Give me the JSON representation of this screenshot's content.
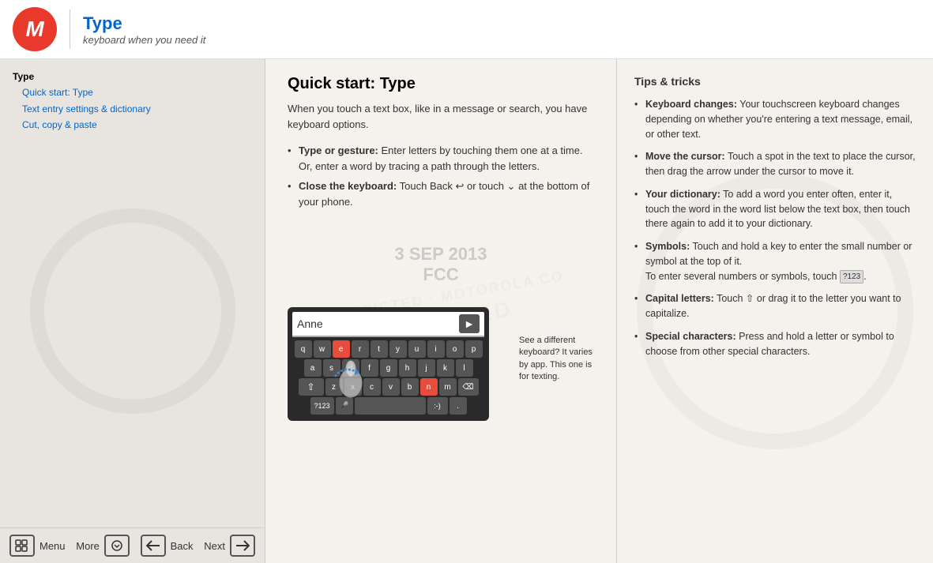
{
  "header": {
    "title": "Type",
    "subtitle": "keyboard when you need it",
    "logo_letter": "M"
  },
  "sidebar": {
    "nav_items": [
      {
        "label": "Type",
        "active": true,
        "indented": false
      },
      {
        "label": "Quick start: Type",
        "active": false,
        "indented": true
      },
      {
        "label": "Text entry settings & dictionary",
        "active": false,
        "indented": true
      },
      {
        "label": "Cut, copy & paste",
        "active": false,
        "indented": true
      }
    ],
    "menu_label": "Menu",
    "more_label": "More",
    "back_label": "Back",
    "next_label": "Next"
  },
  "center": {
    "section_title": "Quick start: Type",
    "intro": "When you touch a text box, like in a message or search, you have keyboard options.",
    "bullets": [
      {
        "bold": "Type or gesture:",
        "text": " Enter letters by touching them one at a time. Or, enter a word by tracing a path through the letters."
      },
      {
        "bold": "Close the keyboard:",
        "text": " Touch Back ↩ or touch ⌄ at the bottom of your phone."
      }
    ],
    "date_stamp": "3 SEP 2013",
    "fcc_text": "FCC",
    "keyboard": {
      "input_text": "Anne",
      "rows": [
        [
          "q",
          "w",
          "e",
          "r",
          "t",
          "y",
          "u",
          "i",
          "o",
          "p"
        ],
        [
          "a",
          "s",
          "d",
          "f",
          "g",
          "h",
          "j",
          "k",
          "l"
        ],
        [
          "⇧",
          "z",
          "x",
          "c",
          "v",
          "b",
          "n",
          "m",
          "⌫"
        ],
        [
          "?123",
          "🎤",
          "",
          "",
          "",
          "",
          "",
          "",
          ":-)",
          "."
        ]
      ]
    },
    "tooltip": "See a different keyboard? It varies by app. This one is for texting."
  },
  "tips": {
    "title": "Tips & tricks",
    "items": [
      {
        "bold": "Keyboard changes:",
        "text": " Your touchscreen keyboard changes depending on whether you're entering a text message, email, or other text."
      },
      {
        "bold": "Move the cursor:",
        "text": " Touch a spot in the text to place the cursor, then drag the arrow under the cursor to move it."
      },
      {
        "bold": "Your dictionary:",
        "text": " To add a word you enter often, enter it, touch the word in the word list below the text box, then touch there again to add it to your dictionary."
      },
      {
        "bold": "Symbols:",
        "text": " Touch and hold a key to enter the small number or symbol at the top of it.",
        "extra": "To enter several numbers or symbols, touch [?123]."
      },
      {
        "bold": "Capital letters:",
        "text": " Touch ⇧ or drag it to the letter you want to capitalize."
      },
      {
        "bold": "Special characters:",
        "text": " Press and hold a letter or symbol to choose from other special characters."
      }
    ]
  }
}
